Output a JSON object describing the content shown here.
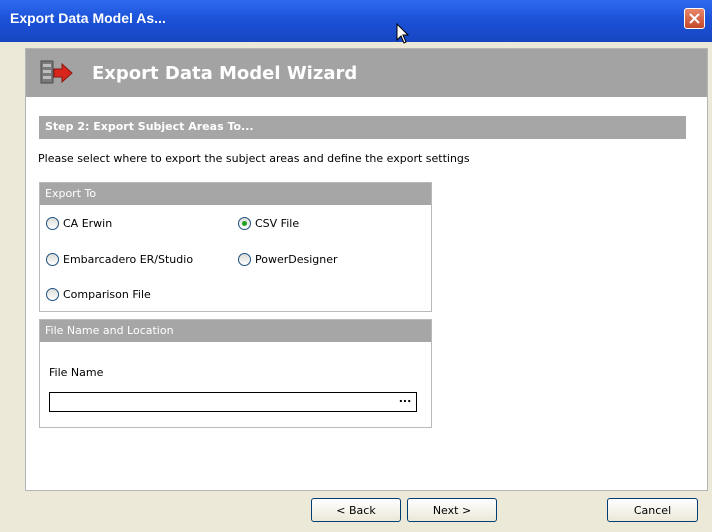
{
  "window": {
    "title": "Export Data Model As..."
  },
  "banner": {
    "title": "Export Data Model Wizard"
  },
  "step": {
    "title": "Step 2: Export Subject Areas To..."
  },
  "description": "Please select where to export the subject areas and define the export settings",
  "export_to": {
    "title": "Export To",
    "options": [
      {
        "label": "CA Erwin",
        "checked": false
      },
      {
        "label": "CSV File",
        "checked": true
      },
      {
        "label": "Embarcadero ER/Studio",
        "checked": false
      },
      {
        "label": "PowerDesigner",
        "checked": false
      },
      {
        "label": "Comparison File",
        "checked": false
      }
    ]
  },
  "file": {
    "title": "File Name and Location",
    "label": "File Name",
    "value": "",
    "browse_label": "..."
  },
  "buttons": {
    "back": "< Back",
    "next": "Next >",
    "cancel": "Cancel"
  },
  "colors": {
    "titlebar": "#1c52d8",
    "header_gray": "#a6a6a6",
    "frame": "#ece9d8",
    "radio_dot": "#21a121"
  }
}
